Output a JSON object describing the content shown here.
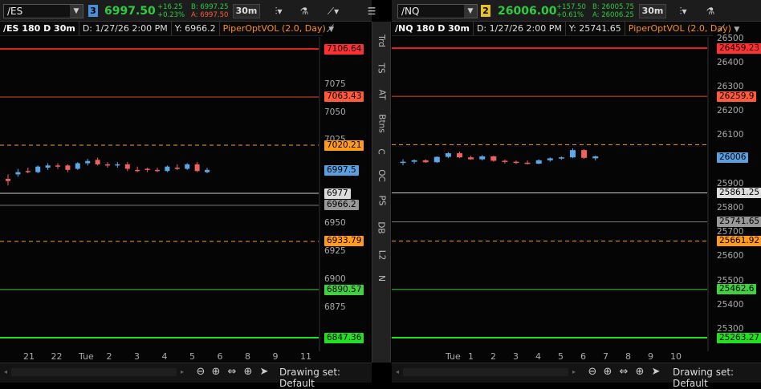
{
  "left": {
    "symbol": "/ES",
    "link_number": "3",
    "link_color": "#4a90d9",
    "last": "6997.50",
    "change": "+16.25",
    "change_pct": "+0.23%",
    "bid": "B: 6997.25",
    "ask": "A: 6997.50",
    "timeframe": "30m",
    "header": {
      "title": "/ES 180 D 30m",
      "date": "D: 1/27/26 2:00 PM",
      "y": "Y: 6966.2",
      "study": "PiperOptVOL (2.0, Day)"
    },
    "yticks": [
      "7075",
      "7050",
      "7025",
      "6950",
      "6925",
      "6900",
      "6875"
    ],
    "xticks": [
      "21",
      "22",
      "Tue",
      "2",
      "3",
      "4",
      "5",
      "6",
      "8",
      "9",
      "11"
    ],
    "levels": [
      {
        "label": "7106.64",
        "value": 7106.64,
        "color": "#e02020",
        "bg": "#ff3030",
        "style": "solid",
        "width": 2
      },
      {
        "label": "7063.43",
        "value": 7063.43,
        "color": "#e84a2a",
        "bg": "#ff5a3a",
        "style": "solid",
        "width": 1
      },
      {
        "label": "7020.21",
        "value": 7020.21,
        "color": "#ff9a1a",
        "bg": "#ff9a1a",
        "style": "dash",
        "width": 1
      },
      {
        "label": "6997.5",
        "value": 6997.5,
        "color": "#5aa0e0",
        "bg": "#5aa0e0",
        "style": "none",
        "width": 1
      },
      {
        "label": "6977",
        "value": 6977,
        "color": "#cccccc",
        "bg": "#dddddd",
        "style": "solid",
        "width": 1
      },
      {
        "label": "6966.2",
        "value": 6966.2,
        "color": "#777777",
        "bg": "#999999",
        "style": "solid",
        "width": 1
      },
      {
        "label": "6933.79",
        "value": 6933.79,
        "color": "#ff9a1a",
        "bg": "#ff9a1a",
        "style": "dash",
        "width": 1
      },
      {
        "label": "6890.57",
        "value": 6890.57,
        "color": "#40d040",
        "bg": "#40d040",
        "style": "solid",
        "width": 1
      },
      {
        "label": "6847.36",
        "value": 6847.36,
        "color": "#20e020",
        "bg": "#20e020",
        "style": "solid",
        "width": 2
      }
    ],
    "candles": [
      [
        6990,
        6994,
        6984,
        6988
      ],
      [
        6994,
        6999,
        6992,
        6996
      ],
      [
        6997,
        7000,
        6995,
        6996
      ],
      [
        6996,
        7002,
        6995,
        7001
      ],
      [
        7000,
        7004,
        6998,
        7002
      ],
      [
        7002,
        7004,
        6999,
        7001
      ],
      [
        7002,
        7003,
        6996,
        6998
      ],
      [
        6999,
        7005,
        6998,
        7004
      ],
      [
        7004,
        7008,
        7002,
        7006
      ],
      [
        7007,
        7009,
        7002,
        7003
      ],
      [
        7003,
        7005,
        7000,
        7002
      ],
      [
        7002,
        7005,
        7000,
        7003
      ],
      [
        7003,
        7005,
        6997,
        6999
      ],
      [
        6998,
        7001,
        6996,
        6997
      ],
      [
        6999,
        7000,
        6996,
        6998
      ],
      [
        6998,
        7000,
        6996,
        6997
      ],
      [
        6997,
        7002,
        6996,
        7001
      ],
      [
        7000,
        7003,
        6998,
        6999
      ],
      [
        6999,
        7004,
        6998,
        7003
      ],
      [
        7003,
        7005,
        6996,
        6997
      ],
      [
        6996,
        7000,
        6995,
        6998
      ]
    ]
  },
  "right": {
    "symbol": "/NQ",
    "link_number": "2",
    "link_color": "#e8c020",
    "last": "26006.00",
    "change": "+157.50",
    "change_pct": "+0.61%",
    "bid": "B: 26005.75",
    "ask": "A: 26006.25",
    "timeframe": "30m",
    "header": {
      "title": "/NQ 180 D 30m",
      "date": "D: 1/27/26 2:00 PM",
      "y": "Y: 25741.65",
      "study": "PiperOptVOL (2.0, Day)"
    },
    "yticks": [
      "26500",
      "26400",
      "26300",
      "26200",
      "26100",
      "25900",
      "25800",
      "25700",
      "25600",
      "25500",
      "25400",
      "25300"
    ],
    "xticks": [
      "Tue",
      "1",
      "2",
      "3",
      "4",
      "5",
      "6",
      "7",
      "8",
      "9",
      "10"
    ],
    "levels": [
      {
        "label": "26459.23",
        "value": 26459.23,
        "color": "#e02020",
        "bg": "#ff3030",
        "style": "solid",
        "width": 2
      },
      {
        "label": "26259.9",
        "value": 26259.9,
        "color": "#e84a2a",
        "bg": "#ff5a3a",
        "style": "solid",
        "width": 1
      },
      {
        "label": "26006",
        "value": 26006,
        "color": "#5aa0e0",
        "bg": "#5aa0e0",
        "style": "none",
        "width": 1
      },
      {
        "label": "26060.58",
        "value": 26060.58,
        "color": "#ff9a1a",
        "bg": "#ff9a1a",
        "style": "dash-nolabel",
        "width": 1
      },
      {
        "label": "25861.25",
        "value": 25861.25,
        "color": "#cccccc",
        "bg": "#dddddd",
        "style": "solid",
        "width": 1
      },
      {
        "label": "25741.65",
        "value": 25741.65,
        "color": "#777777",
        "bg": "#999999",
        "style": "solid",
        "width": 1
      },
      {
        "label": "25661.92",
        "value": 25661.92,
        "color": "#ff9a1a",
        "bg": "#ff9a1a",
        "style": "dash",
        "width": 1
      },
      {
        "label": "25462.6",
        "value": 25462.6,
        "color": "#40d040",
        "bg": "#40d040",
        "style": "solid",
        "width": 1
      },
      {
        "label": "25263.27",
        "value": 25263.27,
        "color": "#20e020",
        "bg": "#20e020",
        "style": "solid",
        "width": 2
      }
    ],
    "candles": [
      [
        25985,
        26000,
        25975,
        25990
      ],
      [
        25990,
        26000,
        25982,
        25996
      ],
      [
        25996,
        26000,
        25985,
        25988
      ],
      [
        25988,
        26012,
        25985,
        26010
      ],
      [
        26010,
        26030,
        26005,
        26025
      ],
      [
        26025,
        26032,
        26005,
        26008
      ],
      [
        26008,
        26015,
        25998,
        26000
      ],
      [
        26000,
        26018,
        25995,
        26012
      ],
      [
        26012,
        26015,
        25990,
        25994
      ],
      [
        25994,
        25999,
        25982,
        25990
      ],
      [
        25990,
        25995,
        25980,
        25986
      ],
      [
        25986,
        25995,
        25978,
        25982
      ],
      [
        25982,
        26000,
        25980,
        25996
      ],
      [
        25996,
        26008,
        25990,
        26004
      ],
      [
        26004,
        26012,
        25998,
        26008
      ],
      [
        26008,
        26045,
        26005,
        26038
      ],
      [
        26038,
        26042,
        26002,
        26006
      ],
      [
        26004,
        26015,
        25995,
        26012
      ]
    ]
  },
  "side_tabs": [
    "Trd",
    "TS",
    "AT",
    "Btns",
    "C",
    "OC",
    "PS",
    "DB",
    "L2",
    "N"
  ],
  "drawing_set": "Drawing set: Default"
}
